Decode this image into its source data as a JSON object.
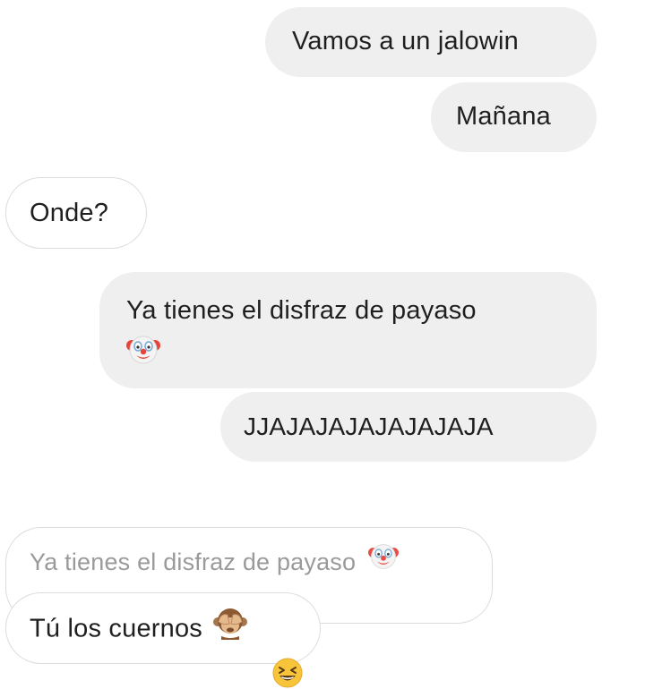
{
  "messages": [
    {
      "direction": "outgoing",
      "text": "Vamos a un jalowin"
    },
    {
      "direction": "outgoing",
      "text": "Mañana"
    },
    {
      "direction": "incoming",
      "text": "Onde?"
    },
    {
      "direction": "outgoing",
      "text": "Ya tienes el disfraz de payaso",
      "emoji": "clown-face-icon"
    },
    {
      "direction": "outgoing",
      "text": "JJAJAJAJAJAJAJAJA"
    }
  ],
  "reply": {
    "quoted_text": "Ya tienes el disfraz de payaso",
    "quoted_emoji": "clown-face-icon",
    "text": "Tú los cuernos",
    "emoji": "see-no-evil-monkey-icon",
    "reaction": "grinning-squinting-face-icon"
  },
  "colors": {
    "outgoing_bubble": "#efefef",
    "incoming_border": "#dcdcdc",
    "quoted_text": "#9a9a9a",
    "text": "#1f1f1f"
  }
}
